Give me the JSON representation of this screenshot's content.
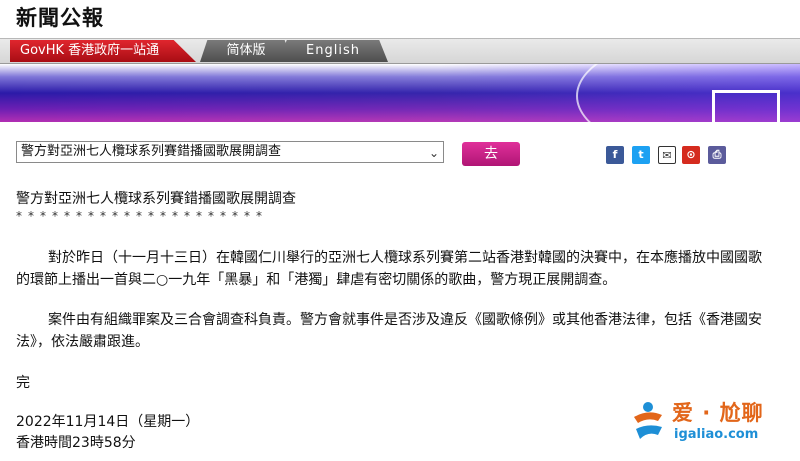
{
  "header": {
    "site_title": "新聞公報"
  },
  "nav": {
    "govhk_label": "GovHK 香港政府一站通",
    "simplified_label": "简体版",
    "english_label": "English"
  },
  "selector": {
    "selected_value": "警方對亞洲七人欖球系列賽錯播國歌展開調查",
    "go_label": "去"
  },
  "share": {
    "facebook_glyph": "f",
    "twitter_glyph": "t",
    "email_glyph": "✉",
    "weibo_glyph": "⊙",
    "print_glyph": "⎙"
  },
  "article": {
    "title": "警方對亞洲七人欖球系列賽錯播國歌展開調查",
    "separator": "*********************",
    "paragraphs": [
      "對於昨日（十一月十三日）在韓國仁川舉行的亞洲七人欖球系列賽第二站香港對韓國的決賽中，在本應播放中國國歌的環節上播出一首與二○一九年「黑暴」和「港獨」肆虐有密切關係的歌曲，警方現正展開調查。",
      "案件由有組織罪案及三合會調查科負責。警方會就事件是否涉及違反《國歌條例》或其他香港法律，包括《香港國安法》，依法嚴肅跟進。"
    ],
    "end_mark": "完",
    "date": "2022年11月14日（星期一）",
    "time": "香港時間23時58分"
  },
  "watermark": {
    "text": "爱 · 尬聊",
    "url": "igaliao.com"
  },
  "colors": {
    "govhk_red": "#c8141c",
    "go_button": "#c81f85",
    "watermark_orange": "#e2661a",
    "watermark_blue": "#1e8fd6"
  }
}
